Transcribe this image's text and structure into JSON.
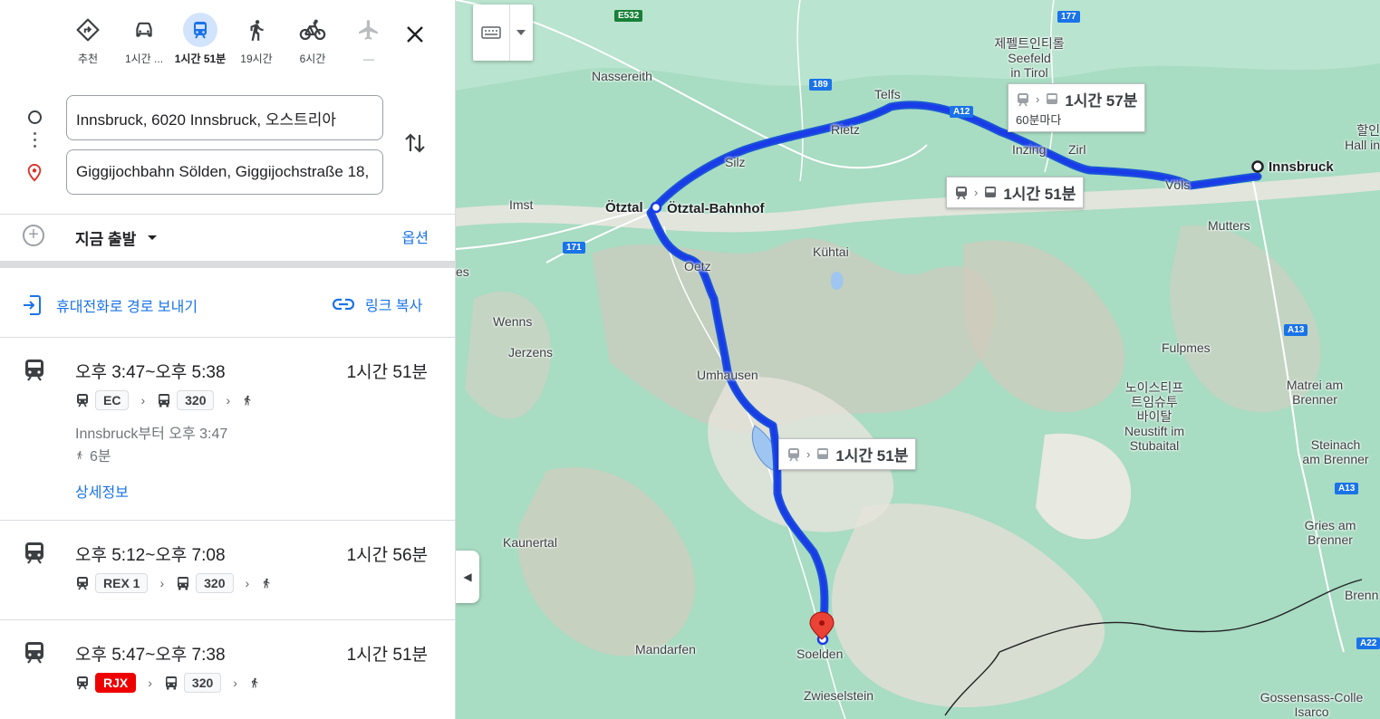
{
  "travel_modes": [
    {
      "key": "best",
      "label": "추천",
      "icon": "directions-diamond-icon"
    },
    {
      "key": "drive",
      "label": "1시간 ...",
      "icon": "car-icon"
    },
    {
      "key": "transit",
      "label": "1시간 51분",
      "icon": "train-icon",
      "active": true
    },
    {
      "key": "walk",
      "label": "19시간",
      "icon": "walk-icon"
    },
    {
      "key": "bike",
      "label": "6시간",
      "icon": "bike-icon"
    },
    {
      "key": "flight",
      "label": "—",
      "icon": "airplane-icon",
      "disabled": true
    }
  ],
  "origin": "Innsbruck, 6020 Innsbruck, 오스트리아",
  "destination": "Giggijochbahn Sölden, Giggijochstraße 18,",
  "depart_label": "지금 출발",
  "options_label": "옵션",
  "send_to_phone": "휴대전화로 경로 보내기",
  "copy_link": "링크 복사",
  "routes": [
    {
      "time": "오후 3:47~오후 5:38",
      "duration": "1시간 51분",
      "train": "EC",
      "bus": "320",
      "from": "Innsbruck부터 오후 3:47",
      "walk": "6분",
      "details": "상세정보"
    },
    {
      "time": "오후 5:12~오후 7:08",
      "duration": "1시간 56분",
      "train": "REX 1",
      "bus": "320"
    },
    {
      "time": "오후 5:47~오후 7:38",
      "duration": "1시간 51분",
      "train": "RJX",
      "bus": "320"
    }
  ],
  "map": {
    "places": {
      "innsbruck": "Innsbruck",
      "otztal": "Ötztal",
      "otztal_bahnhof": "Ötztal-Bahnhof",
      "soelden": "Soelden",
      "nassereith": "Nassereith",
      "seefeld": "제펠트인티롤\nSeefeld\nin Tirol",
      "telfs": "Telfs",
      "rietz": "Rietz",
      "silz": "Silz",
      "inzing": "Inzing",
      "zirl": "Zirl",
      "vols": "Völs",
      "mutters": "Mutters",
      "hall": "할인\nHall in",
      "imst": "Imst",
      "kuhtai": "Kühtai",
      "oetz": "Oetz",
      "wenns": "Wenns",
      "jerzens": "Jerzens",
      "umhausen": "Umhausen",
      "fulpmes": "Fulpmes",
      "neustift": "노이스티프\n트임슈투\n바이탈\nNeustift im\nStubaital",
      "matrei": "Matrei am\nBrenner",
      "steinach": "Steinach\nam Brenner",
      "gries": "Gries am\nBrenner",
      "brenn": "Brenn",
      "kaunertal": "Kaunertal",
      "mandarfen": "Mandarfen",
      "zwieselstein": "Zwieselstein",
      "gossensass": "Gossensass-Colle\nIsarco",
      "es": "es"
    },
    "roads": {
      "e532": "E532",
      "r177": "177",
      "r189": "189",
      "a12": "A12",
      "r171": "171",
      "a13a": "A13",
      "a13b": "A13",
      "a22": "A22"
    },
    "callouts": [
      {
        "duration": "1시간 57분",
        "frequency": "60분마다"
      },
      {
        "duration": "1시간 51분"
      },
      {
        "duration": "1시간 51분"
      }
    ]
  }
}
